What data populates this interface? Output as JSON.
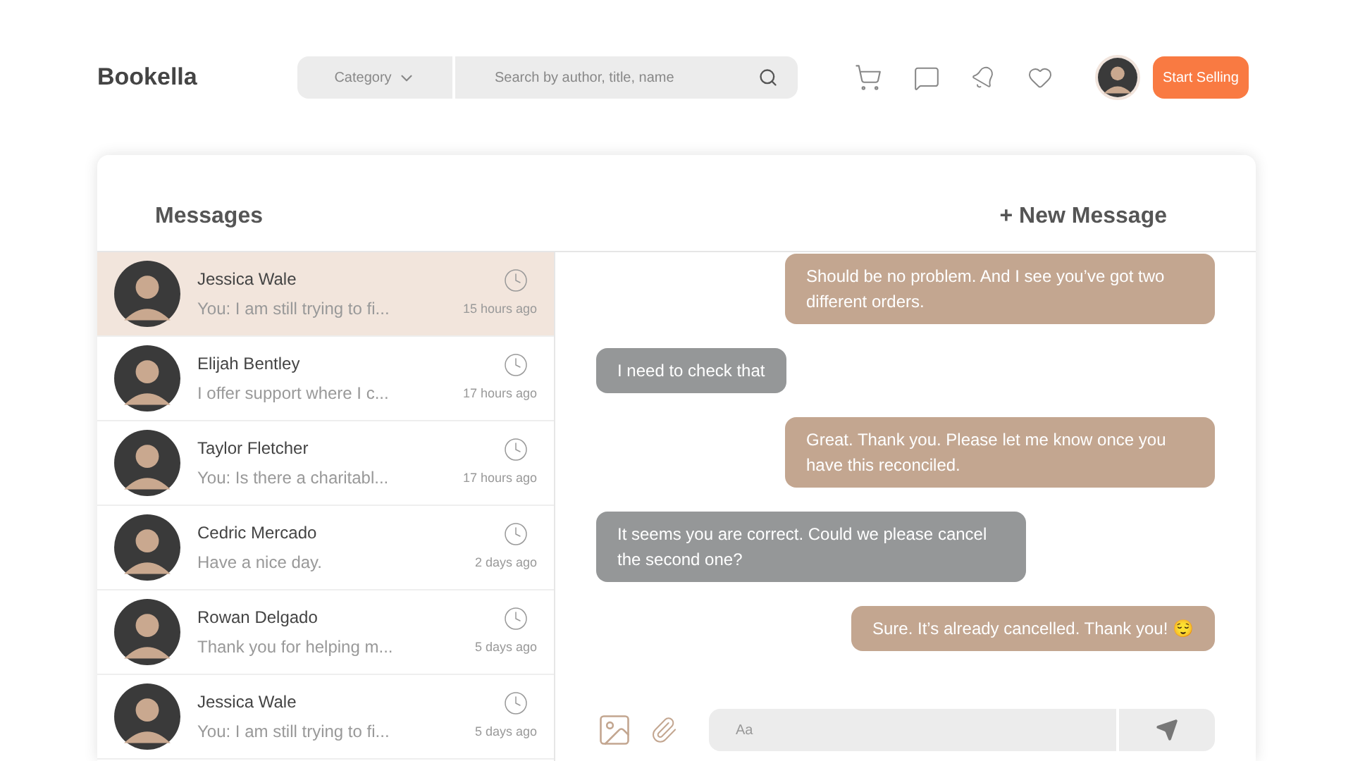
{
  "brand": "Bookella",
  "search": {
    "category": "Category",
    "placeholder": "Search by author, title, name"
  },
  "start_selling": "Start Selling",
  "messages_title": "Messages",
  "new_message": "+ New Message",
  "conversations": [
    {
      "name": "Jessica Wale",
      "preview": "You: I am still trying to fi...",
      "time": "15 hours ago",
      "selected": true
    },
    {
      "name": "Elijah Bentley",
      "preview": "I offer support where I c...",
      "time": "17 hours ago",
      "selected": false
    },
    {
      "name": "Taylor Fletcher",
      "preview": "You: Is there a charitabl...",
      "time": "17 hours ago",
      "selected": false
    },
    {
      "name": "Cedric Mercado",
      "preview": "Have a nice day.",
      "time": "2 days ago",
      "selected": false
    },
    {
      "name": "Rowan Delgado",
      "preview": "Thank you for helping m...",
      "time": "5 days ago",
      "selected": false
    },
    {
      "name": "Jessica Wale",
      "preview": "You: I am still trying to fi...",
      "time": "5 days ago",
      "selected": false
    }
  ],
  "chat": [
    {
      "kind": "sent",
      "text": "Should be no problem. And I see you’ve got two different orders."
    },
    {
      "kind": "received",
      "text": "I need to check that"
    },
    {
      "kind": "sent",
      "text": "Great. Thank you. Please let me know once you have this reconciled."
    },
    {
      "kind": "received",
      "text": "It seems you are correct. Could we please cancel the second one?"
    },
    {
      "kind": "sent",
      "text": "Sure. It’s already cancelled. Thank you! 😌"
    }
  ],
  "composer": {
    "placeholder": "Aa"
  }
}
